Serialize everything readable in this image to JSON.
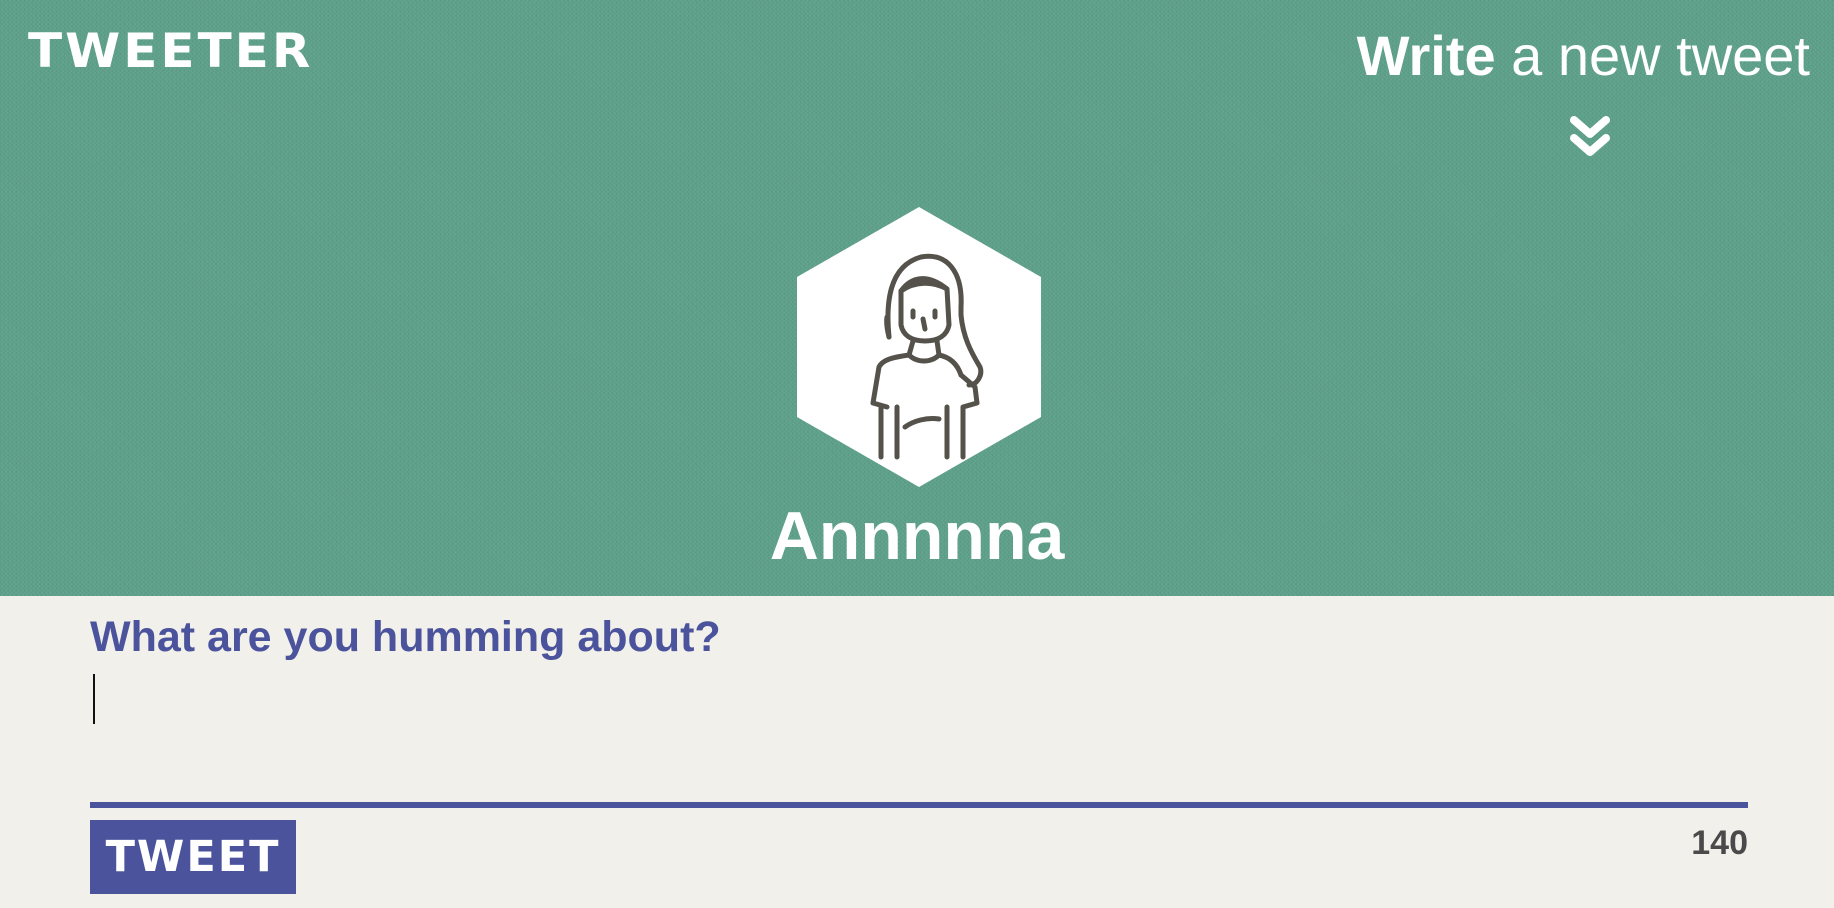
{
  "header": {
    "logo_text": "TWEETER",
    "write_strong": "Write",
    "write_light": " a new tweet",
    "toggle_icon": "double-chevron-down-icon",
    "avatar_icon": "woman-avatar-icon",
    "username": "Annnnna"
  },
  "composer": {
    "prompt": "What are you humming about?",
    "input_value": "",
    "button_label": "TWEET",
    "char_count": "140"
  },
  "colors": {
    "header_bg": "#5fa28c",
    "page_bg": "#f2f0eb",
    "accent": "#4a539c",
    "white": "#ffffff",
    "icon_stroke": "#55514b",
    "counter_text": "#4a4a4a"
  }
}
